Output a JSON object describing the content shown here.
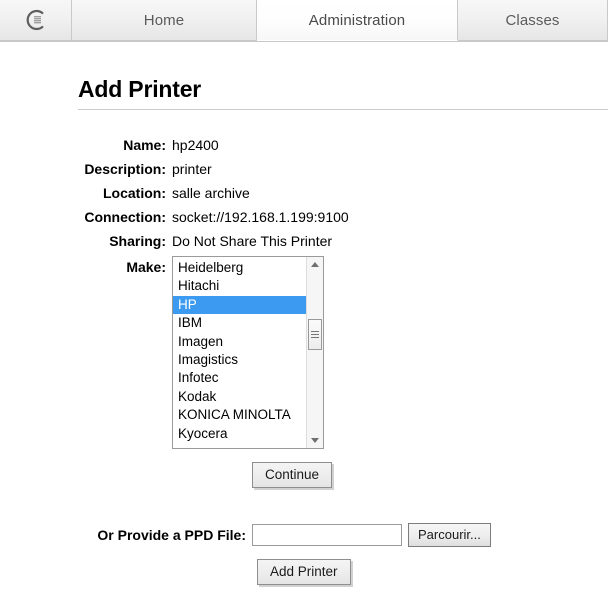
{
  "tabs": [
    {
      "name": "logo",
      "label": "",
      "icon": "cups-logo-icon",
      "active": false
    },
    {
      "name": "home",
      "label": "Home",
      "active": false
    },
    {
      "name": "administration",
      "label": "Administration",
      "active": true
    },
    {
      "name": "classes",
      "label": "Classes",
      "active": false
    }
  ],
  "page": {
    "title": "Add Printer"
  },
  "form": {
    "fields": [
      {
        "label": "Name:",
        "value": "hp2400"
      },
      {
        "label": "Description:",
        "value": "printer"
      },
      {
        "label": "Location:",
        "value": "salle archive"
      },
      {
        "label": "Connection:",
        "value": "socket://192.168.1.199:9100"
      },
      {
        "label": "Sharing:",
        "value": "Do Not Share This Printer"
      }
    ],
    "make": {
      "label": "Make:",
      "selected": "HP",
      "options": [
        "Heidelberg",
        "Hitachi",
        "HP",
        "IBM",
        "Imagen",
        "Imagistics",
        "Infotec",
        "Kodak",
        "KONICA MINOLTA",
        "Kyocera"
      ]
    },
    "continue_label": "Continue",
    "ppd": {
      "label": "Or Provide a PPD File:",
      "value": "",
      "placeholder": "",
      "browse_label": "Parcourir..."
    },
    "add_printer_label": "Add Printer"
  },
  "colors": {
    "selection": "#3c9bf0",
    "tab_text": "#5b5b5b",
    "rule": "#cccccc"
  }
}
